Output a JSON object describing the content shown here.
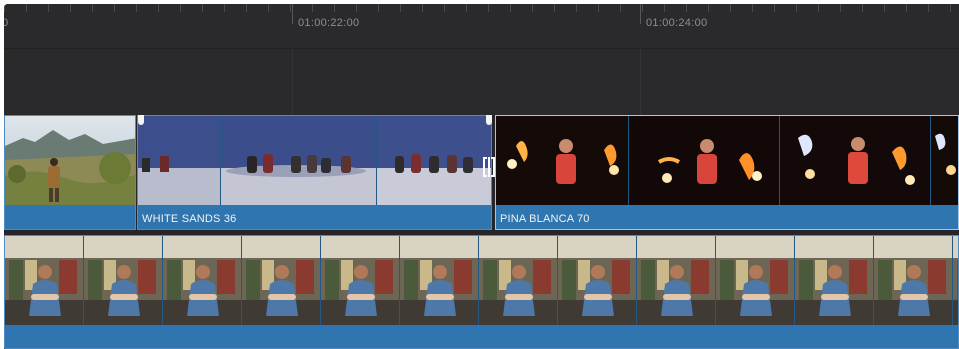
{
  "timeline": {
    "ruler": {
      "timecodes": [
        "0",
        "01:00:22:00",
        "01:00:24:00"
      ]
    },
    "video_track_1": {
      "clips": [
        {
          "label": "",
          "thumbnail": "hiker-in-desert"
        },
        {
          "label": "WHITE SANDS 36",
          "thumbnail": "group-on-dunes"
        },
        {
          "label": "PINA BLANCA 70",
          "thumbnail": "fire-dancer"
        }
      ]
    },
    "video_track_2": {
      "clips": [
        {
          "label": "",
          "thumbnail": "man-in-shop"
        }
      ]
    },
    "colors": {
      "background": "#28282b",
      "clip_blue": "#2f76b0",
      "clip_border": "#4d8cc4",
      "selected_border": "#9cc9ee",
      "timecode": "#8e8e92"
    },
    "icons": [
      "edit-point-handle-icon",
      "trim-cursor-icon"
    ]
  }
}
